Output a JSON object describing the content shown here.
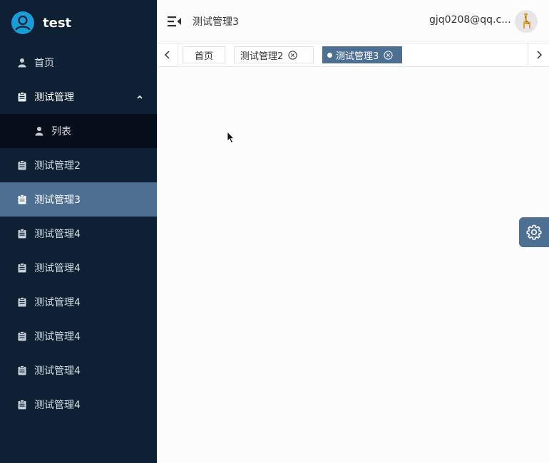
{
  "brand": {
    "title": "test"
  },
  "sidebar": {
    "items": [
      {
        "label": "首页",
        "icon": "user-icon"
      },
      {
        "label": "测试管理",
        "icon": "clipboard-icon",
        "expanded": true,
        "children": [
          {
            "label": "列表",
            "icon": "user-icon"
          }
        ]
      },
      {
        "label": "测试管理2",
        "icon": "clipboard-icon"
      },
      {
        "label": "测试管理3",
        "icon": "clipboard-icon",
        "active": true
      },
      {
        "label": "测试管理4",
        "icon": "clipboard-icon"
      },
      {
        "label": "测试管理4",
        "icon": "clipboard-icon"
      },
      {
        "label": "测试管理4",
        "icon": "clipboard-icon"
      },
      {
        "label": "测试管理4",
        "icon": "clipboard-icon"
      },
      {
        "label": "测试管理4",
        "icon": "clipboard-icon"
      },
      {
        "label": "测试管理4",
        "icon": "clipboard-icon"
      }
    ]
  },
  "header": {
    "title": "测试管理3",
    "user_email": "gjq0208@qq.c..."
  },
  "tabs": [
    {
      "label": "首页",
      "closable": false,
      "active": false
    },
    {
      "label": "测试管理2",
      "closable": true,
      "active": false
    },
    {
      "label": "测试管理3",
      "closable": true,
      "active": true
    }
  ],
  "colors": {
    "sidebar_bg": "#0e2134",
    "accent": "#4d6f92",
    "submenu_bg": "#060f19",
    "logo_blue": "#1b9bd7"
  }
}
